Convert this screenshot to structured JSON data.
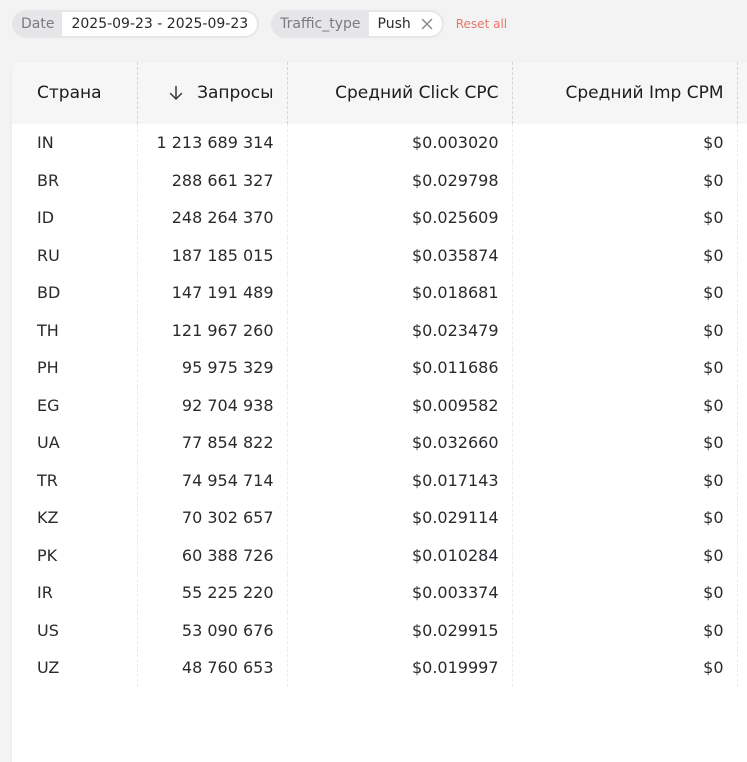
{
  "filters": {
    "date": {
      "label": "Date",
      "value": "2025-09-23 - 2025-09-23"
    },
    "traffic_type": {
      "label": "Traffic_type",
      "value": "Push"
    },
    "reset_label": "Reset all"
  },
  "table": {
    "columns": {
      "country": "Страна",
      "requests": "Запросы",
      "click_cpc": "Средний Click CPC",
      "imp_cpm": "Средний Imp CPM"
    },
    "rows": [
      {
        "country": "IN",
        "requests": "1 213 689 314",
        "click_cpc": "$0.003020",
        "imp_cpm": "$0"
      },
      {
        "country": "BR",
        "requests": "288 661 327",
        "click_cpc": "$0.029798",
        "imp_cpm": "$0"
      },
      {
        "country": "ID",
        "requests": "248 264 370",
        "click_cpc": "$0.025609",
        "imp_cpm": "$0"
      },
      {
        "country": "RU",
        "requests": "187 185 015",
        "click_cpc": "$0.035874",
        "imp_cpm": "$0"
      },
      {
        "country": "BD",
        "requests": "147 191 489",
        "click_cpc": "$0.018681",
        "imp_cpm": "$0"
      },
      {
        "country": "TH",
        "requests": "121 967 260",
        "click_cpc": "$0.023479",
        "imp_cpm": "$0"
      },
      {
        "country": "PH",
        "requests": "95 975 329",
        "click_cpc": "$0.011686",
        "imp_cpm": "$0"
      },
      {
        "country": "EG",
        "requests": "92 704 938",
        "click_cpc": "$0.009582",
        "imp_cpm": "$0"
      },
      {
        "country": "UA",
        "requests": "77 854 822",
        "click_cpc": "$0.032660",
        "imp_cpm": "$0"
      },
      {
        "country": "TR",
        "requests": "74 954 714",
        "click_cpc": "$0.017143",
        "imp_cpm": "$0"
      },
      {
        "country": "KZ",
        "requests": "70 302 657",
        "click_cpc": "$0.029114",
        "imp_cpm": "$0"
      },
      {
        "country": "PK",
        "requests": "60 388 726",
        "click_cpc": "$0.010284",
        "imp_cpm": "$0"
      },
      {
        "country": "IR",
        "requests": "55 225 220",
        "click_cpc": "$0.003374",
        "imp_cpm": "$0"
      },
      {
        "country": "US",
        "requests": "53 090 676",
        "click_cpc": "$0.029915",
        "imp_cpm": "$0"
      },
      {
        "country": "UZ",
        "requests": "48 760 653",
        "click_cpc": "$0.019997",
        "imp_cpm": "$0"
      }
    ]
  },
  "icons": {
    "sort": "arrow-down-icon",
    "remove_filter": "close-icon"
  },
  "colors": {
    "reset_accent": "#e5776a"
  }
}
